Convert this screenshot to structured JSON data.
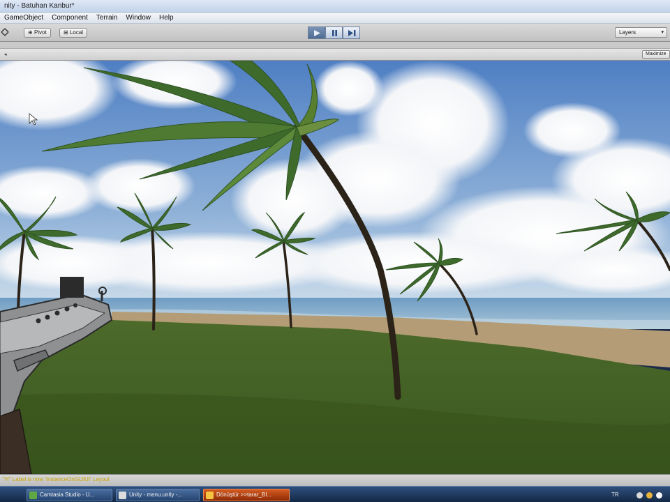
{
  "window": {
    "title": "nity - Batuhan Kanbur*"
  },
  "menu": {
    "items": [
      "GameObject",
      "Component",
      "Terrain",
      "Window",
      "Help"
    ]
  },
  "toolbar": {
    "pivot_label": "Pivot",
    "local_label": "Local",
    "layers_label": "Layers",
    "layers_arrow": "▾",
    "play_icons": [
      "play-icon",
      "pause-icon",
      "step-icon"
    ]
  },
  "gameview": {
    "maximize_label": "Maximize",
    "left_arrow": "◂"
  },
  "statusbar": {
    "text": "\"H\" Label is now 'InstanceOnGUIUI' Layout"
  },
  "taskbar": {
    "items": [
      {
        "label": "Camtasia Studio - U...",
        "icon": "camtasia-icon"
      },
      {
        "label": "Unity - menu.unity -...",
        "icon": "unity-icon"
      },
      {
        "label": "Dönüştür >>tarar_BI...",
        "icon": "converter-icon"
      }
    ],
    "tray_text": "TR"
  },
  "colors": {
    "sky_top": "#5b86c4",
    "sky_horizon": "#c8d9ea",
    "grass": "#4d6b2b",
    "sand": "#b8a07a",
    "sea": "#5f8fb8",
    "active_task": "#d45a21"
  }
}
